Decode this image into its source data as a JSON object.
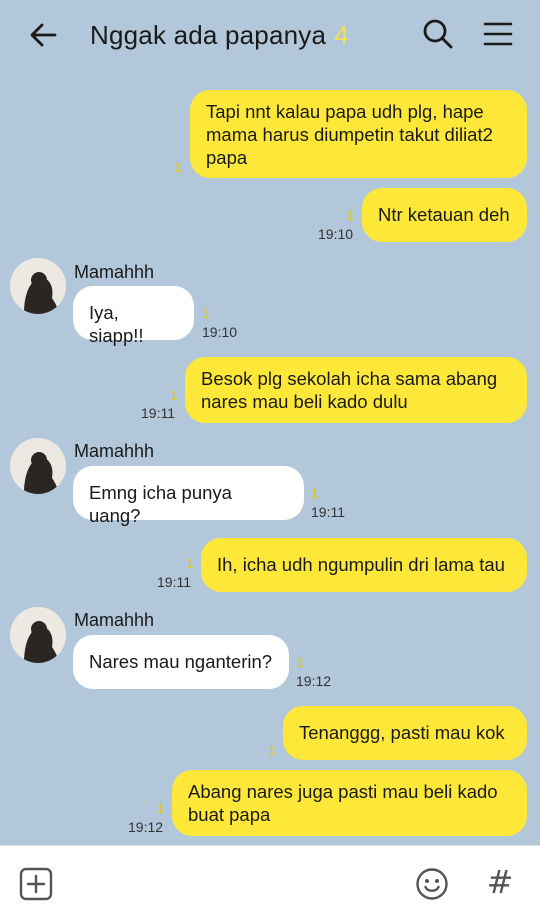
{
  "header": {
    "title": "Nggak ada papanya",
    "member_count": "4",
    "back_icon": "arrow-left-icon",
    "search_icon": "search-icon",
    "menu_icon": "hamburger-menu-icon"
  },
  "messages": [
    {
      "lines": [
        "Tapi nnt kalau papa udh plg, hape",
        "mama harus diumpetin takut diliat2",
        "papa"
      ],
      "read": "1",
      "time": ""
    },
    {
      "lines": [
        "Ntr ketauan deh"
      ],
      "read": "1",
      "time": "19:10"
    },
    {
      "sender": "Mamahhh",
      "lines": [
        "Iya, siapp!!"
      ],
      "read": "1",
      "time": "19:10"
    },
    {
      "lines": [
        "Besok plg sekolah icha sama abang",
        "nares mau beli kado dulu"
      ],
      "read": "1",
      "time": "19:11"
    },
    {
      "sender": "Mamahhh",
      "lines": [
        "Emng icha punya uang?"
      ],
      "read": "1",
      "time": "19:11"
    },
    {
      "lines": [
        "Ih, icha udh ngumpulin dri lama tau"
      ],
      "read": "1",
      "time": "19:11"
    },
    {
      "sender": "Mamahhh",
      "lines": [
        "Nares mau nganterin?"
      ],
      "read": "1",
      "time": "19:12"
    },
    {
      "lines": [
        "Tenanggg, pasti mau kok"
      ],
      "read": "1",
      "time": ""
    },
    {
      "lines": [
        "Abang nares juga pasti mau beli kado",
        "buat papa"
      ],
      "read": "1",
      "time": "19:12"
    }
  ],
  "input_bar": {
    "attach_icon": "plus-square-icon",
    "emoji_icon": "emoji-icon",
    "hash_label": "#"
  },
  "colors": {
    "background": "#b2c7d9",
    "outgoing_bubble": "#fde83a",
    "incoming_bubble": "#ffffff",
    "read_count": "#e6c800"
  }
}
